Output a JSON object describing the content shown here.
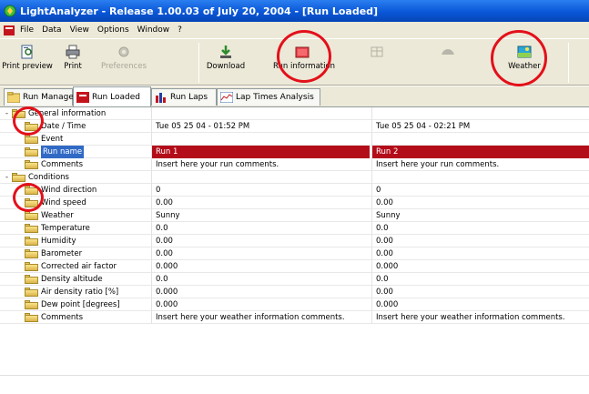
{
  "window": {
    "title": "LightAnalyzer  -  Release 1.00.03 of July 20, 2004 - [Run Loaded]"
  },
  "menu": [
    "File",
    "Data",
    "View",
    "Options",
    "Window",
    "?"
  ],
  "toolbar": {
    "print_preview": "Print preview",
    "print": "Print",
    "preferences": "Preferences",
    "download": "Download",
    "run_information": "Run information",
    "weather": "Weather"
  },
  "tabs": [
    "Run Manager",
    "Run Loaded",
    "Run Laps",
    "Lap Times Analysis"
  ],
  "rows": [
    {
      "label": "General information",
      "level": 0,
      "v1": "",
      "v2": ""
    },
    {
      "label": "Date / Time",
      "level": 1,
      "v1": "Tue 05 25 04  -  01:52 PM",
      "v2": "Tue 05 25 04  -  02:21 PM"
    },
    {
      "label": "Event",
      "level": 1,
      "v1": "",
      "v2": ""
    },
    {
      "label": "Run name",
      "level": 1,
      "v1": "Run 1",
      "v2": "Run 2"
    },
    {
      "label": "Comments",
      "level": 1,
      "v1": "Insert here your run comments.",
      "v2": "Insert here your run comments."
    },
    {
      "label": "Conditions",
      "level": 0,
      "v1": "",
      "v2": ""
    },
    {
      "label": "Wind direction",
      "level": 1,
      "v1": "0",
      "v2": "0"
    },
    {
      "label": "Wind speed",
      "level": 1,
      "v1": "0.00",
      "v2": "0.00"
    },
    {
      "label": "Weather",
      "level": 1,
      "v1": "Sunny",
      "v2": "Sunny"
    },
    {
      "label": "Temperature",
      "level": 1,
      "v1": "0.0",
      "v2": "0.0"
    },
    {
      "label": "Humidity",
      "level": 1,
      "v1": "0.00",
      "v2": "0.00"
    },
    {
      "label": "Barometer",
      "level": 1,
      "v1": "0.00",
      "v2": "0.00"
    },
    {
      "label": "Corrected air factor",
      "level": 1,
      "v1": "0.000",
      "v2": "0.000"
    },
    {
      "label": "Density altitude",
      "level": 1,
      "v1": "0.0",
      "v2": "0.0"
    },
    {
      "label": "Air density ratio [%]",
      "level": 1,
      "v1": "0.000",
      "v2": "0.00"
    },
    {
      "label": "Dew point [degrees]",
      "level": 1,
      "v1": "0.000",
      "v2": "0.000"
    },
    {
      "label": "Comments",
      "level": 1,
      "v1": "Insert here your weather information comments.",
      "v2": "Insert here your weather information comments."
    }
  ],
  "colors": {
    "title_bar": "#0a57d8",
    "selection_red": "#b30d1a",
    "annotation_circle": "#e3101a"
  }
}
